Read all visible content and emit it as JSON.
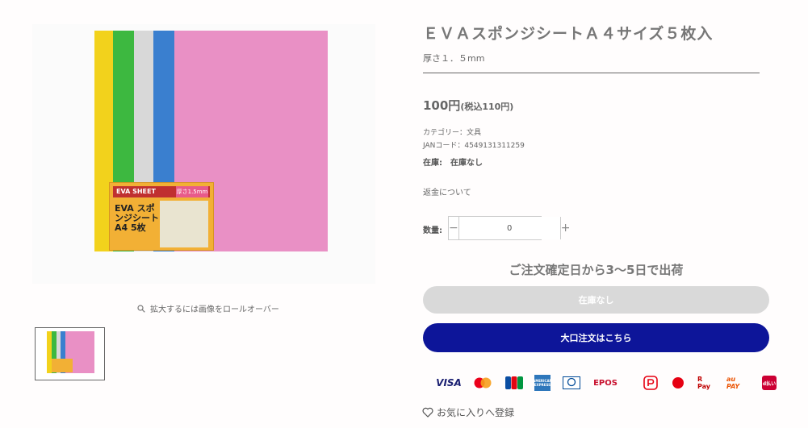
{
  "product": {
    "title": "ＥＶＡスポンジシートＡ４サイズ５枚入",
    "subtitle": "厚さ１．５mm",
    "price": "100円",
    "price_tax": "(税込110円)",
    "category": "カテゴリー：文具",
    "jan": "JANコード：4549131311259",
    "stock": "在庫:　在庫なし",
    "refund_link": "返金について"
  },
  "gallery": {
    "zoom_hint": "拡大するには画像をロールオーバー",
    "sheet_colors": [
      "#f2d21c",
      "#3db840",
      "#d8d8d8",
      "#3a7fcf",
      "#e990c5"
    ],
    "package_text": "EVA スポンジシート A4 5枚",
    "package_badge": "厚さ1.5mm",
    "package_brand": "EVA SHEET"
  },
  "quantity": {
    "label": "数量:",
    "value": "0",
    "minus": "−",
    "plus": "+"
  },
  "shipping_note": "ご注文確定日から3〜5日で出荷",
  "buttons": {
    "sold_out": "在庫なし",
    "bulk_order": "大口注文はこちら"
  },
  "payments": [
    {
      "name": "VISA",
      "color": "#1a1f71"
    },
    {
      "name": "Mastercard",
      "color": "#eb001b"
    },
    {
      "name": "JCB",
      "color": "#0b4ea2"
    },
    {
      "name": "AMERICAN EXPRESS",
      "color": "#2e77bb"
    },
    {
      "name": "Diners Club",
      "color": "#004a97"
    },
    {
      "name": "EPOS",
      "color": "#c8102e"
    },
    {
      "name": "PayPay",
      "color": "#e60012"
    },
    {
      "name": "Pay",
      "color": "#e60012"
    },
    {
      "name": "R Pay",
      "color": "#bf0000"
    },
    {
      "name": "au PAY",
      "color": "#eb5505"
    },
    {
      "name": "d払い",
      "color": "#cc0033"
    }
  ],
  "wishlist": "お気に入りへ登録"
}
